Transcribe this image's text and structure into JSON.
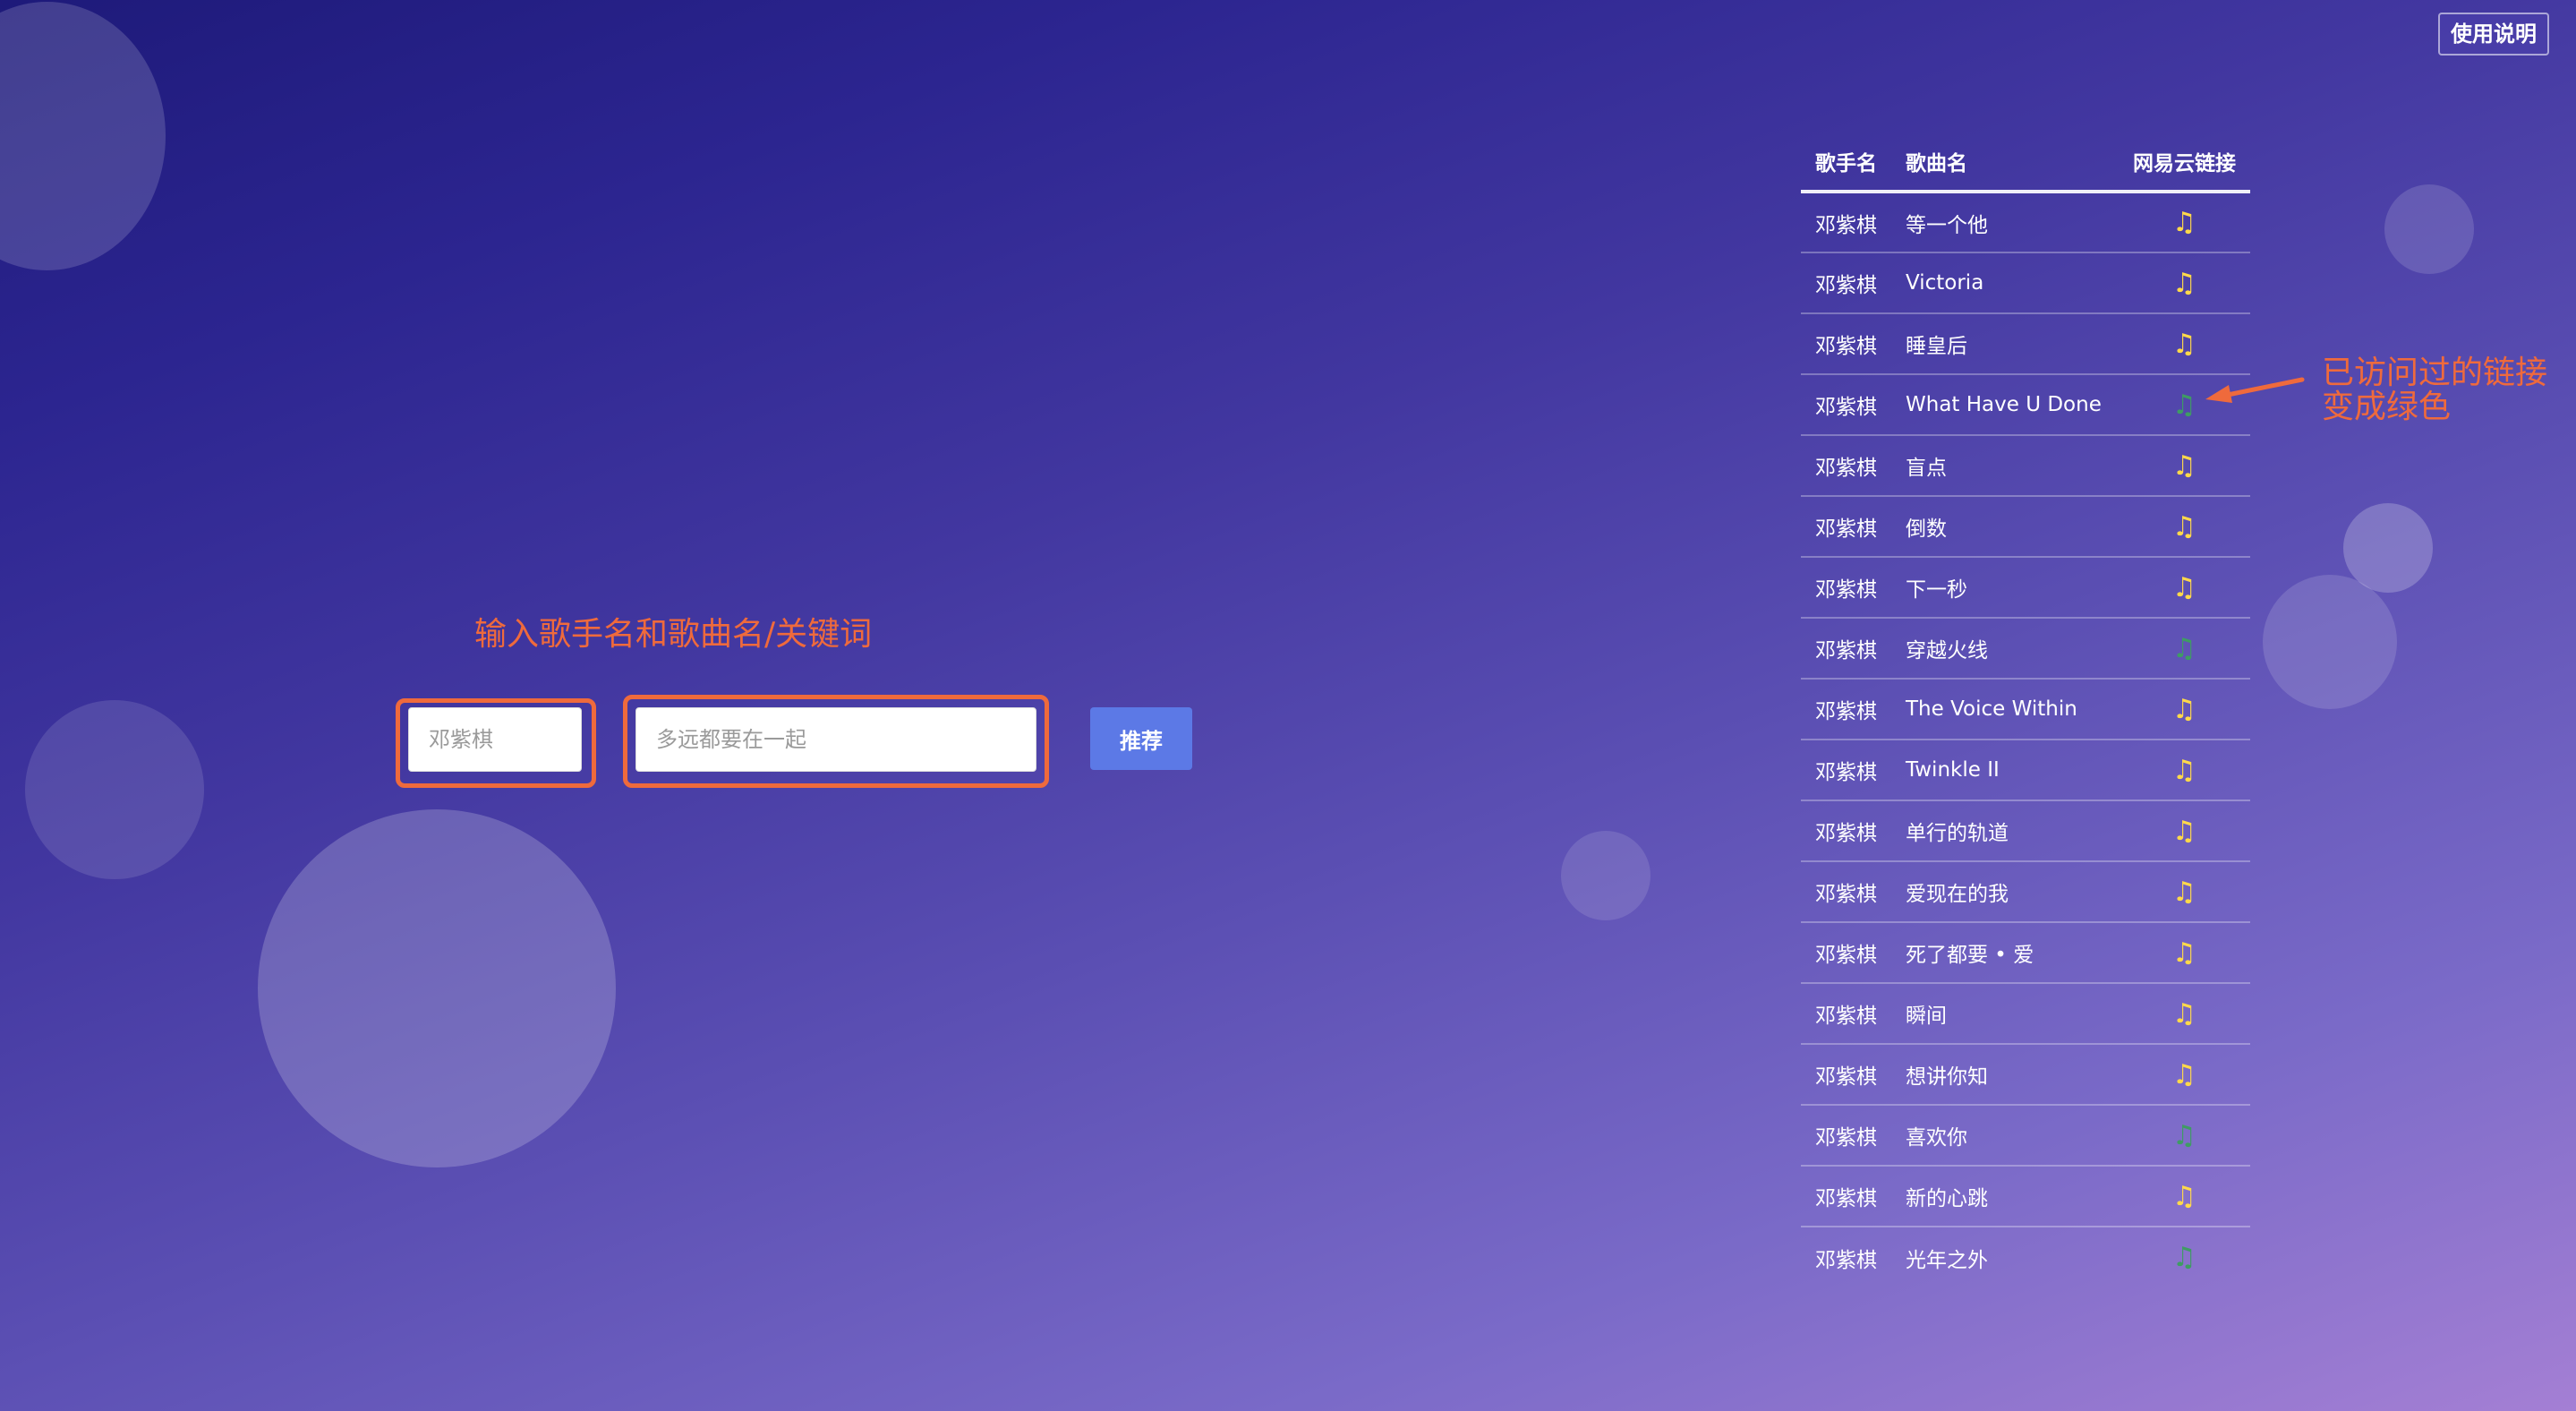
{
  "help_button": {
    "label": "使用说明"
  },
  "annotations": {
    "input_hint": "输入歌手名和歌曲名/关键词",
    "visited_line1": "已访问过的链接",
    "visited_line2": "变成绿色"
  },
  "search": {
    "singer_placeholder": "邓紫棋",
    "song_placeholder": "多远都要在一起",
    "submit_label": "推荐"
  },
  "table": {
    "headers": {
      "singer": "歌手名",
      "song": "歌曲名",
      "link": "网易云链接"
    },
    "link_icon": "music-note-icon",
    "link_color": "#ffd94a",
    "visited_link_color": "#3f9c63",
    "rows": [
      {
        "singer": "邓紫棋",
        "song": "等一个他",
        "visited": false
      },
      {
        "singer": "邓紫棋",
        "song": "Victoria",
        "visited": false
      },
      {
        "singer": "邓紫棋",
        "song": "睡皇后",
        "visited": false
      },
      {
        "singer": "邓紫棋",
        "song": "What Have U Done",
        "visited": true
      },
      {
        "singer": "邓紫棋",
        "song": "盲点",
        "visited": false
      },
      {
        "singer": "邓紫棋",
        "song": "倒数",
        "visited": false
      },
      {
        "singer": "邓紫棋",
        "song": "下一秒",
        "visited": false
      },
      {
        "singer": "邓紫棋",
        "song": "穿越火线",
        "visited": true
      },
      {
        "singer": "邓紫棋",
        "song": "The Voice Within",
        "visited": false
      },
      {
        "singer": "邓紫棋",
        "song": "Twinkle II",
        "visited": false
      },
      {
        "singer": "邓紫棋",
        "song": "单行的轨道",
        "visited": false
      },
      {
        "singer": "邓紫棋",
        "song": "爱现在的我",
        "visited": false
      },
      {
        "singer": "邓紫棋",
        "song": "死了都要 • 爱",
        "visited": false
      },
      {
        "singer": "邓紫棋",
        "song": "瞬间",
        "visited": false
      },
      {
        "singer": "邓紫棋",
        "song": "想讲你知",
        "visited": false
      },
      {
        "singer": "邓紫棋",
        "song": "喜欢你",
        "visited": true
      },
      {
        "singer": "邓紫棋",
        "song": "新的心跳",
        "visited": false
      },
      {
        "singer": "邓紫棋",
        "song": "光年之外",
        "visited": true
      }
    ]
  }
}
